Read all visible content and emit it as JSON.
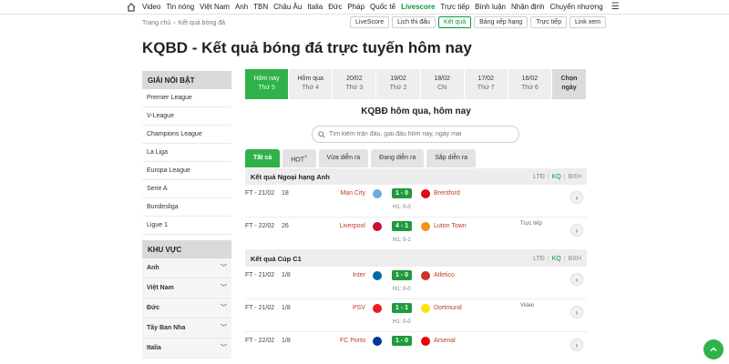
{
  "topnav": {
    "items": [
      "Video",
      "Tin nóng",
      "Việt Nam",
      "Anh",
      "TBN",
      "Châu Âu",
      "Italia",
      "Đức",
      "Pháp",
      "Quốc tế",
      "Livescore",
      "Trực tiếp",
      "Bình luận",
      "Nhận định",
      "Chuyển nhượng"
    ],
    "active": "Livescore"
  },
  "breadcrumb": {
    "home": "Trang chủ",
    "current": "Kết quả bóng đá"
  },
  "subtabs": [
    "LiveScore",
    "Lịch thi đấu",
    "Kết quả",
    "Bảng xếp hạng",
    "Trực tiếp",
    "Link xem"
  ],
  "subtab_active": "Kết quả",
  "page_title": "KQBD - Kết quả bóng đá trực tuyến hôm nay",
  "sidebar": {
    "featured_title": "GIẢI NỔI BẬT",
    "featured": [
      "Premier League",
      "V-League",
      "Champions League",
      "La Liga",
      "Europa League",
      "Serie A",
      "Bundesliga",
      "Ligue 1"
    ],
    "region_title": "KHU VỰC",
    "regions": [
      "Anh",
      "Việt Nam",
      "Đức",
      "Tây Ban Nha",
      "Italia"
    ]
  },
  "datetabs": [
    {
      "top": "Hôm nay",
      "sub": "Thứ 5"
    },
    {
      "top": "Hôm qua",
      "sub": "Thứ 4"
    },
    {
      "top": "20/02",
      "sub": "Thứ 3"
    },
    {
      "top": "19/02",
      "sub": "Thứ 2"
    },
    {
      "top": "18/02",
      "sub": "CN"
    },
    {
      "top": "17/02",
      "sub": "Thứ 7"
    },
    {
      "top": "16/02",
      "sub": "Thứ 6"
    },
    {
      "top": "Chọn",
      "sub": "ngày"
    }
  ],
  "section_title": "KQBĐ hôm qua, hôm nay",
  "search": {
    "placeholder": "Tìm kiếm trận đấu, giải đấu hôm nay, ngày mai"
  },
  "filters": [
    "Tất cả",
    "HOT",
    "Vừa diễn ra",
    "Đang diễn ra",
    "Sắp diễn ra"
  ],
  "filters_hot_mark": "+",
  "competitions": [
    {
      "title": "Kết quả Ngoại hạng Anh",
      "links": [
        "LTĐ",
        "KQ",
        "BXH"
      ],
      "matches": [
        {
          "time": "FT - 21/02",
          "round": "18",
          "home": "Man City",
          "score": "1 - 0",
          "away": "Brentford",
          "ht": "H1: 0-0",
          "extra": "",
          "home_color": "#6cabdd",
          "away_color": "#e30613"
        },
        {
          "time": "FT - 22/02",
          "round": "26",
          "home": "Liverpool",
          "score": "4 - 1",
          "away": "Luton Town",
          "ht": "H1: 0-1",
          "extra": "Trực tiếp",
          "home_color": "#c8102e",
          "away_color": "#f78f1e"
        }
      ]
    },
    {
      "title": "Kết quả Cúp C1",
      "links": [
        "LTĐ",
        "KQ",
        "BXH"
      ],
      "matches": [
        {
          "time": "FT - 21/02",
          "round": "1/8",
          "home": "Inter",
          "score": "1 - 0",
          "away": "Atletico",
          "ht": "H1: 0-0",
          "extra": "",
          "home_color": "#0068a8",
          "away_color": "#cb3524"
        },
        {
          "time": "FT - 21/02",
          "round": "1/8",
          "home": "PSV",
          "score": "1 - 1",
          "away": "Dortmund",
          "ht": "H1: 0-0",
          "extra": "Video",
          "home_color": "#ed1c24",
          "away_color": "#fde100"
        },
        {
          "time": "FT - 22/02",
          "round": "1/8",
          "home": "FC Porto",
          "score": "1 - 0",
          "away": "Arsenal",
          "ht": "",
          "extra": "",
          "home_color": "#003893",
          "away_color": "#ef0107"
        }
      ]
    }
  ],
  "colors": {
    "brand_green": "#2fb24a",
    "score_green": "#1f9a3d",
    "team_red": "#c23b22"
  },
  "icons": {
    "home": "home-icon",
    "menu": "hamburger-menu-icon",
    "search": "search-icon",
    "arrow": "chevron-right-icon",
    "scroll_top": "chevron-up-icon"
  }
}
